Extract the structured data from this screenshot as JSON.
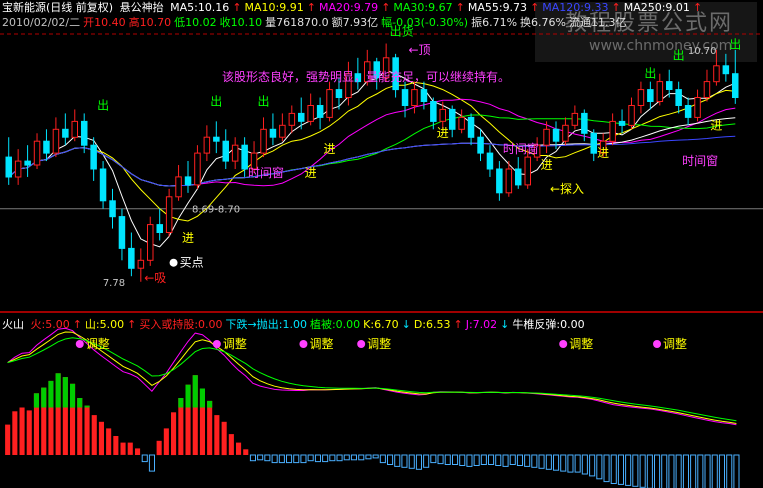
{
  "colors": {
    "bg": "#000000",
    "up": "#ff2020",
    "down": "#00e5ff",
    "ma5": "#ffffff",
    "ma10": "#ffff00",
    "ma20": "#ff00ff",
    "ma30": "#00ff00",
    "ma55": "#ffffff",
    "ma120": "#3a46ff",
    "ma250": "#ffffff",
    "label": "#ffff00",
    "alert": "#ff00ff",
    "note": "#ff40ff",
    "grid": "#b00000"
  },
  "watermark": {
    "title": "教程股票公式网",
    "url": "www.chnmoney.com"
  },
  "header": {
    "stock": "宝新能源(日线 前复权)",
    "indicator": "悬公神抬",
    "ma": [
      {
        "label": "MA5:10.16",
        "color": "#ffffff",
        "arrow": "↑"
      },
      {
        "label": "MA10:9.91",
        "color": "#ffff00",
        "arrow": "↑"
      },
      {
        "label": "MA20:9.79",
        "color": "#ff00ff",
        "arrow": "↑"
      },
      {
        "label": "MA30:9.67",
        "color": "#00ff00",
        "arrow": "↑"
      },
      {
        "label": "MA55:9.73",
        "color": "#ffffff",
        "arrow": "↑"
      },
      {
        "label": "MA120:9.33",
        "color": "#3a46ff",
        "arrow": "↑"
      },
      {
        "label": "MA250:9.01",
        "color": "#ffffff",
        "arrow": "↑"
      }
    ],
    "quote": [
      {
        "text": "2010/02/02/二",
        "color": "#c0c0c0"
      },
      {
        "text": "开10.40",
        "color": "#ff2020"
      },
      {
        "text": "高10.70",
        "color": "#ff2020"
      },
      {
        "text": "低10.02",
        "color": "#00ff00"
      },
      {
        "text": "收10.10",
        "color": "#00ff00"
      },
      {
        "text": "量761870.0",
        "color": "#e0e0e0"
      },
      {
        "text": "额7.93亿",
        "color": "#e0e0e0"
      },
      {
        "text": "幅-0.03(-0.30%)",
        "color": "#00ff00"
      },
      {
        "text": "振6.71%",
        "color": "#e0e0e0"
      },
      {
        "text": "换6.76%",
        "color": "#e0e0e0"
      },
      {
        "text": "流通11.3亿",
        "color": "#e0e0e0"
      }
    ]
  },
  "sub": {
    "name": "火山",
    "items": [
      {
        "text": "火:5.00",
        "color": "#ff2020",
        "arrow": "↑"
      },
      {
        "text": "山:5.00",
        "color": "#ffff00",
        "arrow": "↑"
      },
      {
        "text": "买入或持股:0.00",
        "color": "#ff2020",
        "arrow": ""
      },
      {
        "text": "下跌→抛出:1.00",
        "color": "#00e5ff",
        "arrow": ""
      },
      {
        "text": "植被:0.00",
        "color": "#00ff00",
        "arrow": ""
      },
      {
        "text": "K:6.70",
        "color": "#ffff00",
        "arrow": "↓"
      },
      {
        "text": "D:6.53",
        "color": "#ffff00",
        "arrow": "↑"
      },
      {
        "text": "J:7.02",
        "color": "#ff00ff",
        "arrow": "↓"
      },
      {
        "text": "牛椎反弹:0.00",
        "color": "#ffffff",
        "arrow": ""
      }
    ]
  },
  "chart_data": {
    "type": "candlestick",
    "period": "日线 前复权",
    "current_date": "2010/02/02",
    "price_range": [
      7.5,
      10.9
    ],
    "candles": [
      [
        9.35,
        9.1,
        9.6,
        9.0
      ],
      [
        9.1,
        9.3,
        9.45,
        9.0
      ],
      [
        9.3,
        9.25,
        9.5,
        9.1
      ],
      [
        9.25,
        9.55,
        9.65,
        9.2
      ],
      [
        9.55,
        9.4,
        9.7,
        9.3
      ],
      [
        9.4,
        9.7,
        9.85,
        9.35
      ],
      [
        9.7,
        9.6,
        9.9,
        9.5
      ],
      [
        9.6,
        9.8,
        9.95,
        9.55
      ],
      [
        9.8,
        9.5,
        9.9,
        9.4
      ],
      [
        9.5,
        9.2,
        9.6,
        9.05
      ],
      [
        9.2,
        8.8,
        9.3,
        8.7
      ],
      [
        8.8,
        8.6,
        8.95,
        8.45
      ],
      [
        8.6,
        8.2,
        8.7,
        8.05
      ],
      [
        8.2,
        7.95,
        8.4,
        7.85
      ],
      [
        7.95,
        8.05,
        8.2,
        7.78
      ],
      [
        8.05,
        8.5,
        8.6,
        7.98
      ],
      [
        8.5,
        8.4,
        8.7,
        8.3
      ],
      [
        8.4,
        8.85,
        8.95,
        8.35
      ],
      [
        8.85,
        9.1,
        9.25,
        8.8
      ],
      [
        9.1,
        9.0,
        9.3,
        8.9
      ],
      [
        9.0,
        9.4,
        9.5,
        8.95
      ],
      [
        9.4,
        9.6,
        9.75,
        9.3
      ],
      [
        9.6,
        9.55,
        9.8,
        9.4
      ],
      [
        9.55,
        9.3,
        9.7,
        9.2
      ],
      [
        9.3,
        9.5,
        9.6,
        9.2
      ],
      [
        9.5,
        9.2,
        9.6,
        9.1
      ],
      [
        9.2,
        9.4,
        9.55,
        9.15
      ],
      [
        9.4,
        9.7,
        9.85,
        9.35
      ],
      [
        9.7,
        9.6,
        9.9,
        9.5
      ],
      [
        9.6,
        9.75,
        9.9,
        9.55
      ],
      [
        9.75,
        9.9,
        10.0,
        9.65
      ],
      [
        9.9,
        9.8,
        10.1,
        9.7
      ],
      [
        9.8,
        10.0,
        10.15,
        9.75
      ],
      [
        10.0,
        9.85,
        10.1,
        9.7
      ],
      [
        9.85,
        10.2,
        10.3,
        9.8
      ],
      [
        10.2,
        10.1,
        10.35,
        9.95
      ],
      [
        10.1,
        10.4,
        10.55,
        10.0
      ],
      [
        10.4,
        10.3,
        10.6,
        10.2
      ],
      [
        10.3,
        10.55,
        10.7,
        10.25
      ],
      [
        10.55,
        10.35,
        10.6,
        10.2
      ],
      [
        10.35,
        10.6,
        10.78,
        10.3
      ],
      [
        10.6,
        10.2,
        10.65,
        10.1
      ],
      [
        10.2,
        10.0,
        10.3,
        9.85
      ],
      [
        10.0,
        10.2,
        10.3,
        9.9
      ],
      [
        10.2,
        10.05,
        10.3,
        9.95
      ],
      [
        10.05,
        9.8,
        10.1,
        9.7
      ],
      [
        9.8,
        9.95,
        10.05,
        9.7
      ],
      [
        9.95,
        9.7,
        10.0,
        9.6
      ],
      [
        9.7,
        9.85,
        9.95,
        9.65
      ],
      [
        9.85,
        9.6,
        9.9,
        9.5
      ],
      [
        9.6,
        9.4,
        9.7,
        9.3
      ],
      [
        9.4,
        9.2,
        9.5,
        9.1
      ],
      [
        9.2,
        8.9,
        9.3,
        8.8
      ],
      [
        8.9,
        9.2,
        9.3,
        8.85
      ],
      [
        9.2,
        9.0,
        9.35,
        8.95
      ],
      [
        9.0,
        9.35,
        9.45,
        8.95
      ],
      [
        9.35,
        9.5,
        9.6,
        9.3
      ],
      [
        9.5,
        9.7,
        9.8,
        9.4
      ],
      [
        9.7,
        9.55,
        9.8,
        9.45
      ],
      [
        9.55,
        9.75,
        9.85,
        9.5
      ],
      [
        9.75,
        9.9,
        10.0,
        9.7
      ],
      [
        9.9,
        9.65,
        9.95,
        9.55
      ],
      [
        9.65,
        9.4,
        9.7,
        9.3
      ],
      [
        9.4,
        9.55,
        9.65,
        9.35
      ],
      [
        9.55,
        9.8,
        9.9,
        9.5
      ],
      [
        9.8,
        9.75,
        9.95,
        9.65
      ],
      [
        9.75,
        10.0,
        10.1,
        9.7
      ],
      [
        10.0,
        10.2,
        10.3,
        9.9
      ],
      [
        10.2,
        10.05,
        10.3,
        9.95
      ],
      [
        10.05,
        10.3,
        10.4,
        10.0
      ],
      [
        10.3,
        10.2,
        10.45,
        10.1
      ],
      [
        10.2,
        10.0,
        10.3,
        9.9
      ],
      [
        10.0,
        9.85,
        10.1,
        9.75
      ],
      [
        9.85,
        10.1,
        10.2,
        9.8
      ],
      [
        10.1,
        10.3,
        10.45,
        10.05
      ],
      [
        10.3,
        10.5,
        10.7,
        10.25
      ],
      [
        10.5,
        10.4,
        10.65,
        10.3
      ],
      [
        10.4,
        10.1,
        10.7,
        10.02
      ]
    ],
    "price_labels": [
      {
        "text": "7.78",
        "candle": 14,
        "price": 7.78
      },
      {
        "text": "10.70",
        "candle": 76,
        "price": 10.7
      },
      {
        "text": "8.69-8.70",
        "candle": 19,
        "price": 8.7
      }
    ],
    "signals": [
      {
        "text": "出",
        "candle": 10,
        "price": 9.95,
        "color": "#00ff00"
      },
      {
        "text": "出",
        "candle": 22,
        "price": 10.0,
        "color": "#00ff00"
      },
      {
        "text": "出",
        "candle": 27,
        "price": 10.0,
        "color": "#00ff00"
      },
      {
        "text": "出",
        "candle": 68,
        "price": 10.35,
        "color": "#00ff00"
      },
      {
        "text": "出",
        "candle": 71,
        "price": 10.58,
        "color": "#00ff00"
      },
      {
        "text": "出",
        "candle": 77,
        "price": 10.72,
        "color": "#00ff00"
      },
      {
        "text": "出货",
        "candle": 41,
        "price": 10.88,
        "color": "#00ff00"
      },
      {
        "text": "进",
        "candle": 19,
        "price": 8.28,
        "color": "#ffff00"
      },
      {
        "text": "进",
        "candle": 34,
        "price": 9.4,
        "color": "#ffff00"
      },
      {
        "text": "进",
        "candle": 46,
        "price": 9.6,
        "color": "#ffff00"
      },
      {
        "text": "进",
        "candle": 57,
        "price": 9.2,
        "color": "#ffff00"
      },
      {
        "text": "进",
        "candle": 63,
        "price": 9.35,
        "color": "#ffff00"
      },
      {
        "text": "进",
        "candle": 75,
        "price": 9.7,
        "color": "#ffff00"
      },
      {
        "text": "进",
        "candle": 32,
        "price": 9.1,
        "color": "#ffff00"
      },
      {
        "text": "时间窗",
        "candle": 26,
        "price": 9.1,
        "color": "#ff40ff"
      },
      {
        "text": "时间窗",
        "candle": 53,
        "price": 9.4,
        "color": "#ff40ff"
      },
      {
        "text": "时间窗",
        "candle": 72,
        "price": 9.25,
        "color": "#ff40ff"
      },
      {
        "text": "←顶",
        "candle": 43,
        "price": 10.65,
        "color": "#ff40ff"
      },
      {
        "text": "←吸",
        "candle": 15,
        "price": 7.78,
        "color": "#ff2020"
      },
      {
        "text": "←探入",
        "candle": 58,
        "price": 8.9,
        "color": "#ffff00"
      },
      {
        "text": "买点",
        "candle": 18,
        "price": 8.02,
        "color": "#ffffff"
      }
    ],
    "annotation": {
      "text": "该股形态良好，强势明显，量能充足，可以继续持有。",
      "color": "#ff40ff"
    },
    "sub_chart": {
      "name": "火山",
      "tags": [
        {
          "text": "调整",
          "bar": 10
        },
        {
          "text": "调整",
          "bar": 29
        },
        {
          "text": "调整",
          "bar": 41
        },
        {
          "text": "调整",
          "bar": 49
        },
        {
          "text": "调整",
          "bar": 77
        },
        {
          "text": "调整",
          "bar": 90
        }
      ],
      "bars": [
        3.2,
        4.6,
        5.0,
        4.7,
        6.5,
        7.1,
        7.8,
        8.6,
        8.2,
        7.5,
        6.0,
        5.2,
        4.2,
        3.5,
        2.8,
        2.0,
        1.3,
        1.3,
        0.7,
        -0.7,
        -1.7,
        1.5,
        2.8,
        4.5,
        6.0,
        7.4,
        8.4,
        7.0,
        5.7,
        4.2,
        3.5,
        2.2,
        1.3,
        0.6,
        -0.6,
        -0.5,
        -0.6,
        -0.8,
        -0.8,
        -0.8,
        -0.8,
        -0.8,
        -0.6,
        -0.7,
        -0.7,
        -0.6,
        -0.6,
        -0.5,
        -0.5,
        -0.5,
        -0.4,
        -0.3,
        -0.8,
        -1.0,
        -1.2,
        -1.3,
        -1.4,
        -1.5,
        -1.3,
        -0.8,
        -0.9,
        -1.0,
        -1.0,
        -1.1,
        -1.2,
        -1.1,
        -1.0,
        -1.0,
        -1.1,
        -1.2,
        -1.0,
        -1.1,
        -1.2,
        -1.3,
        -1.4,
        -1.5,
        -1.6,
        -1.7,
        -1.8,
        -1.8,
        -2.0,
        -2.2,
        -2.5,
        -2.8,
        -3.0,
        -3.1,
        -3.2,
        -3.3,
        -3.4,
        -3.5,
        -3.7,
        -3.9,
        -4.1,
        -4.3,
        -4.6,
        -4.8,
        -5.0,
        -5.2,
        -5.4,
        -5.5,
        -5.6,
        -5.8
      ]
    }
  }
}
